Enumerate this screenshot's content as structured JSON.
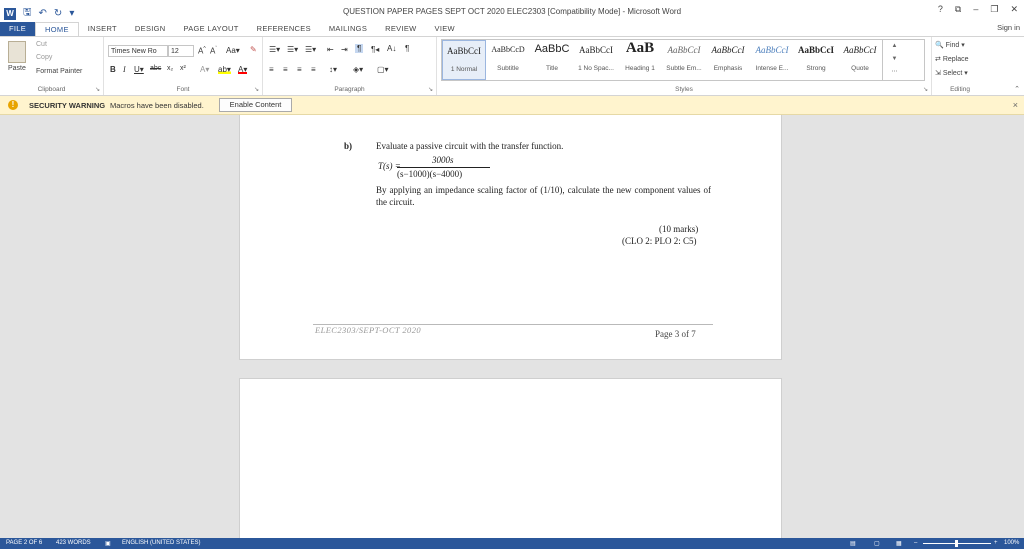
{
  "window": {
    "title": "QUESTION PAPER PAGES SEPT OCT 2020 ELEC2303 [Compatibility Mode] - Microsoft Word",
    "help": "?",
    "restore": "⧉",
    "minimize": "–",
    "maximize": "❐",
    "close": "✕"
  },
  "qat": {
    "logo": "W",
    "save": "🖫",
    "undo": "↶",
    "redo": "↻",
    "more": "▾"
  },
  "tabs": [
    "FILE",
    "HOME",
    "INSERT",
    "DESIGN",
    "PAGE LAYOUT",
    "REFERENCES",
    "MAILINGS",
    "REVIEW",
    "VIEW"
  ],
  "signin": "Sign in",
  "ribbon": {
    "clipboard": {
      "paste": "Paste",
      "cut": "Cut",
      "copy": "Copy",
      "format_painter": "Format Painter",
      "label": "Clipboard"
    },
    "font": {
      "name": "Times New Ro",
      "size": "12",
      "label": "Font"
    },
    "paragraph": {
      "label": "Paragraph"
    },
    "styles": {
      "label": "Styles",
      "items": [
        {
          "sample": "AaBbCcI",
          "name": "1 Normal"
        },
        {
          "sample": "AaBbCcD",
          "name": "Subtitle"
        },
        {
          "sample": "AaBbC",
          "name": "Title"
        },
        {
          "sample": "AaBbCcI",
          "name": "1 No Spac..."
        },
        {
          "sample": "AaB",
          "name": "Heading 1"
        },
        {
          "sample": "AaBbCcI",
          "name": "Subtle Em..."
        },
        {
          "sample": "AaBbCcI",
          "name": "Emphasis"
        },
        {
          "sample": "AaBbCcI",
          "name": "Intense E..."
        },
        {
          "sample": "AaBbCcI",
          "name": "Strong"
        },
        {
          "sample": "AaBbCcI",
          "name": "Quote"
        }
      ]
    },
    "editing": {
      "find": "Find",
      "replace": "Replace",
      "select": "Select",
      "label": "Editing"
    }
  },
  "security_bar": {
    "title": "SECURITY WARNING",
    "message": "Macros have been disabled.",
    "button": "Enable Content",
    "close": "×"
  },
  "document": {
    "question_label": "b)",
    "question_text": "Evaluate a passive circuit with the transfer function.",
    "tf_lhs": "T(s) =",
    "tf_numerator": "3000s",
    "tf_denominator": "(s−1000)(s−4000)",
    "paragraph": "By applying an impedance scaling factor of (1/10), calculate the new component values of the circuit.",
    "marks": "(10 marks)",
    "clo": "(CLO 2: PLO 2: C5)",
    "footer_left": "ELEC2303/SEPT-OCT 2020",
    "footer_right": "Page 3 of 7"
  },
  "status": {
    "page": "PAGE 2 OF 6",
    "words": "423 WORDS",
    "language": "ENGLISH (UNITED STATES)",
    "zoom": "100%"
  },
  "colors": {
    "accent": "#2b579a",
    "security_bar_bg": "#fff4ce"
  }
}
